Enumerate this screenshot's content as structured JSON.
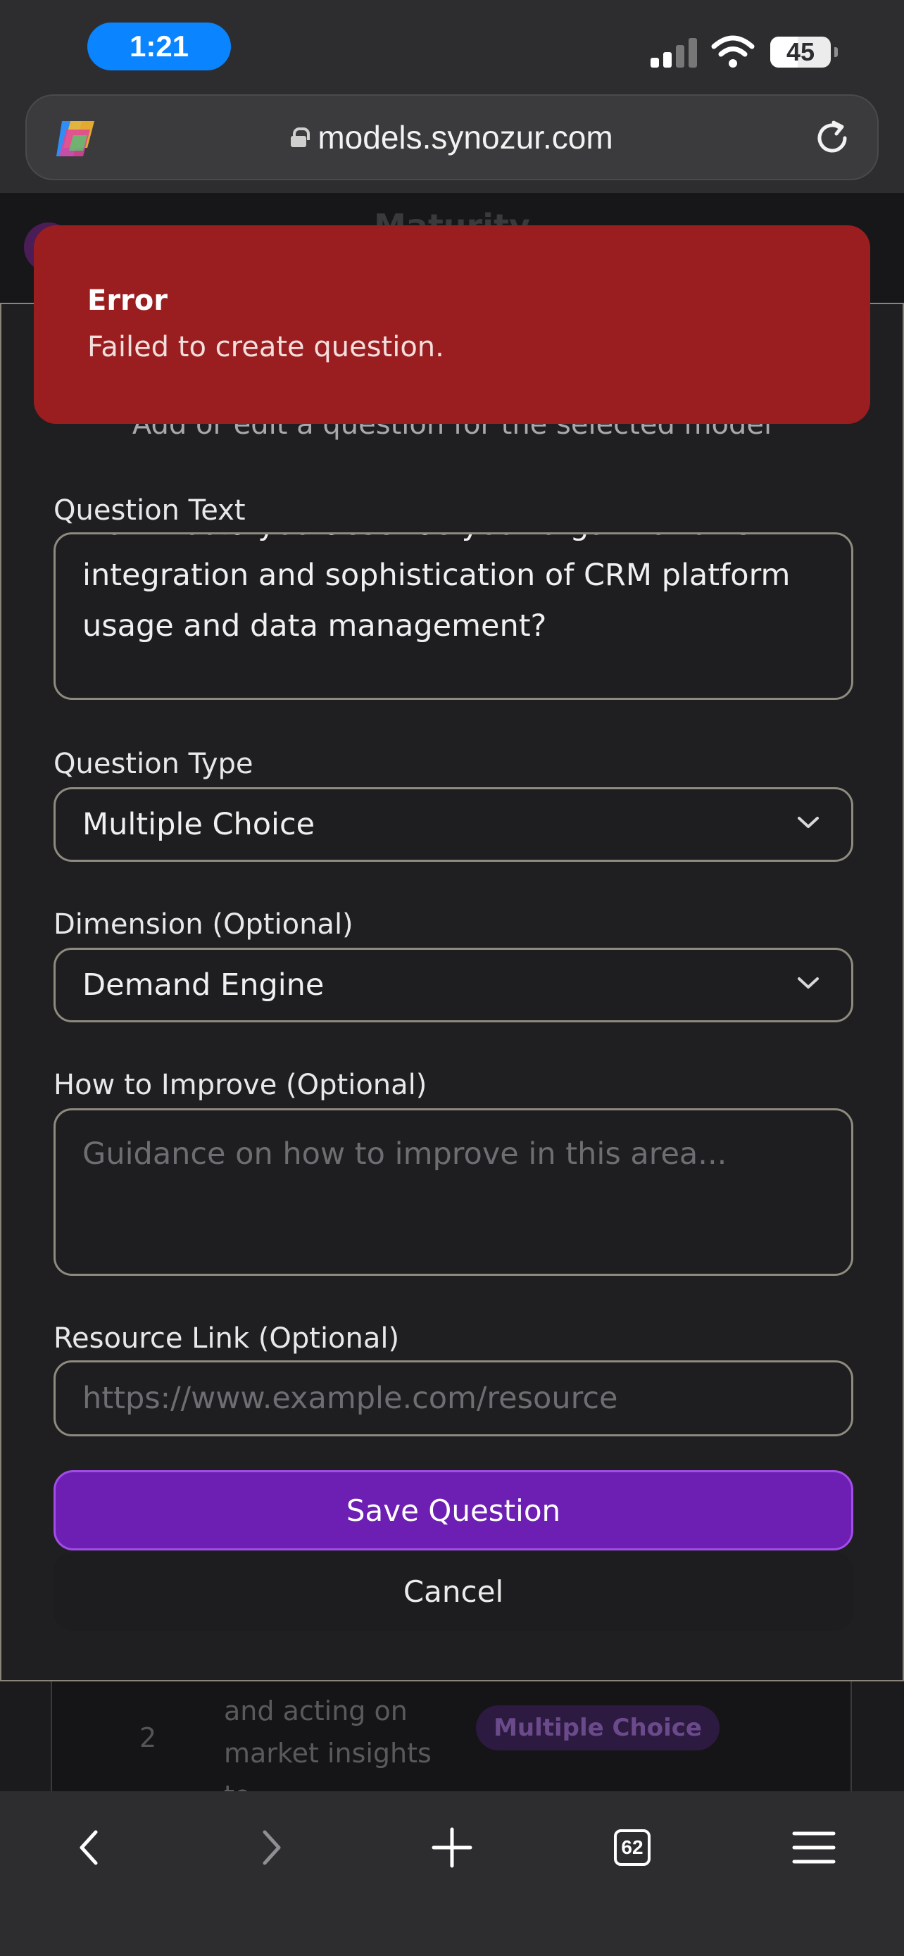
{
  "status_bar": {
    "time": "1:21",
    "battery": "45",
    "battery_level": 0.45
  },
  "browser": {
    "url": "models.synozur.com",
    "tab_count": "62"
  },
  "background_page": {
    "title": "Maturity",
    "row_number": "2",
    "row_text": "and acting on market insights to",
    "row_badge": "Multiple Choice"
  },
  "toast": {
    "title": "Error",
    "message": "Failed to create question."
  },
  "dialog": {
    "subtitle": "Add or edit a question for the selected model",
    "question_text": {
      "label": "Question Text",
      "value": "How would you describe your organization's integration and sophistication of CRM platform usage and data management?"
    },
    "question_type": {
      "label": "Question Type",
      "value": "Multiple Choice"
    },
    "dimension": {
      "label": "Dimension (Optional)",
      "value": "Demand Engine"
    },
    "how_to_improve": {
      "label": "How to Improve (Optional)",
      "placeholder": "Guidance on how to improve in this area..."
    },
    "resource_link": {
      "label": "Resource Link (Optional)",
      "placeholder": "https://www.example.com/resource"
    },
    "save_label": "Save Question",
    "cancel_label": "Cancel"
  }
}
